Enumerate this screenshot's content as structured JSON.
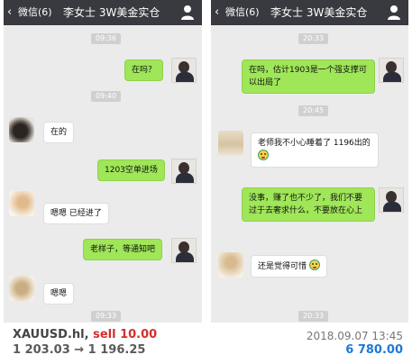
{
  "left_chat": {
    "back_label": "微信(6)",
    "title": "李女士 3W美金实仓",
    "times": [
      "09:36",
      "09:40",
      "09:33"
    ],
    "messages": [
      "在吗？",
      "在的",
      "1203空单进场",
      "嗯嗯 已经进了",
      "老样子，等通知吧",
      "嗯嗯"
    ]
  },
  "right_chat": {
    "back_label": "微信(6)",
    "title": "李女士 3W美金实仓",
    "times": [
      "20:33",
      "20:45",
      "20:33"
    ],
    "messages": [
      "在吗，估计1903是一个强支撑可以出局了",
      "老师我不小心睡着了 1196出的",
      "没事，赚了也不少了，我们不要过于去奢求什么，不要放在心上",
      "还是觉得可惜"
    ]
  },
  "trade": {
    "symbol": "XAUUSD.hl,",
    "action": "sell 10.00",
    "prices": "1 203.03 → 1 196.25",
    "datetime": "2018.09.07 13:45",
    "profit": "6 780.00"
  },
  "icons": {
    "back": "chevron-left-icon",
    "user": "user-icon",
    "emoji": "crying-emoji-icon"
  }
}
